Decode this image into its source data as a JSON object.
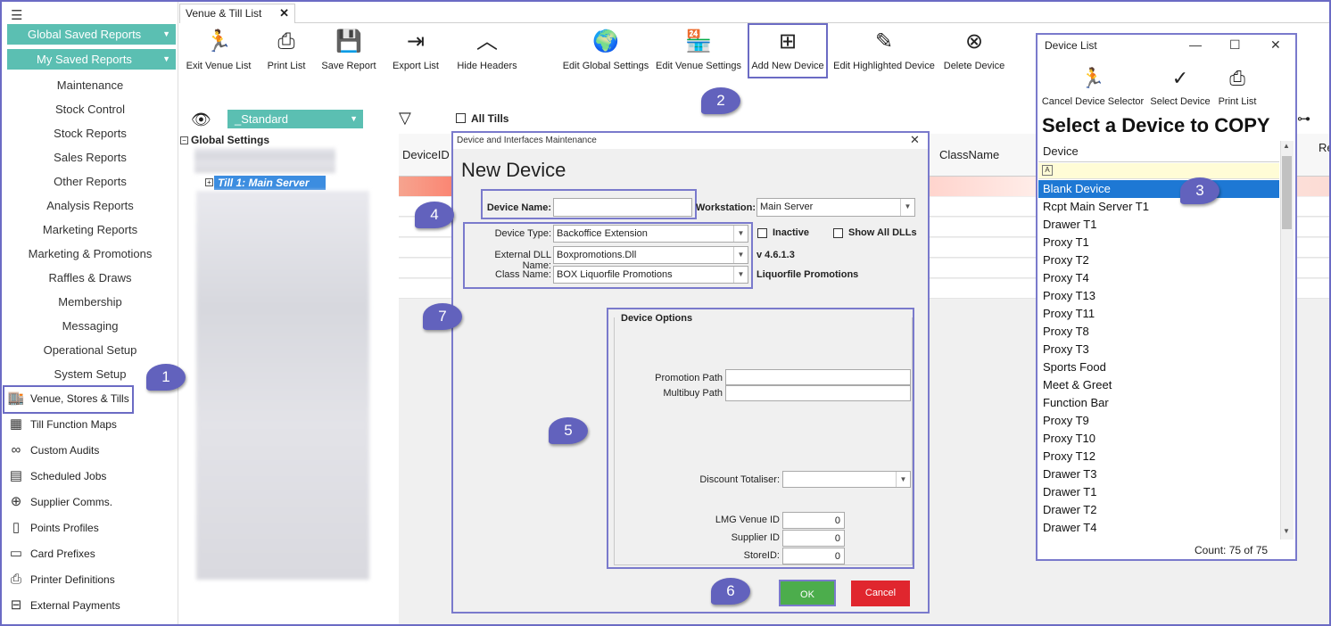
{
  "sidebar": {
    "global_saved": "Global Saved Reports",
    "my_saved": "My Saved Reports",
    "menu": [
      "Maintenance",
      "Stock Control",
      "Stock Reports",
      "Sales Reports",
      "Other Reports",
      "Analysis Reports",
      "Marketing Reports",
      "Marketing & Promotions",
      "Raffles & Draws",
      "Membership",
      "Messaging",
      "Operational Setup",
      "System Setup"
    ],
    "icon_items": [
      {
        "label": "Venue, Stores & Tills",
        "icon": "store-icon"
      },
      {
        "label": "Till Function Maps",
        "icon": "grid-icon"
      },
      {
        "label": "Custom Audits",
        "icon": "binoculars-icon"
      },
      {
        "label": "Scheduled Jobs",
        "icon": "calendar-icon"
      },
      {
        "label": "Supplier Comms.",
        "icon": "upload-icon"
      },
      {
        "label": "Points Profiles",
        "icon": "document-icon"
      },
      {
        "label": "Card Prefixes",
        "icon": "card-icon"
      },
      {
        "label": "Printer Definitions",
        "icon": "printer-icon"
      },
      {
        "label": "External Payments",
        "icon": "payment-icon"
      }
    ]
  },
  "tab": {
    "label": "Venue & Till List"
  },
  "toolbar": [
    {
      "label": "Exit Venue List",
      "icon": "exit-icon"
    },
    {
      "label": "Print List",
      "icon": "printer-icon"
    },
    {
      "label": "Save Report",
      "icon": "save-icon"
    },
    {
      "label": "Export List",
      "icon": "export-icon"
    },
    {
      "label": "Hide Headers",
      "icon": "chevron-up-icon"
    },
    {
      "label": "Edit Global Settings",
      "icon": "globe-icon"
    },
    {
      "label": "Edit Venue Settings",
      "icon": "venue-icon"
    },
    {
      "label": "Add New Device",
      "icon": "add-device-icon"
    },
    {
      "label": "Edit Highlighted Device",
      "icon": "edit-device-icon"
    },
    {
      "label": "Delete Device",
      "icon": "delete-device-icon"
    }
  ],
  "filter": {
    "report_select": "_Standard",
    "all_tills": "All Tills"
  },
  "tree": {
    "root": "Global Settings",
    "till": "Till 1: Main Server"
  },
  "grid": {
    "columns": [
      "DeviceID",
      "ClassName",
      "Re"
    ]
  },
  "dialog": {
    "title": "Device and Interfaces Maintenance",
    "heading": "New Device",
    "device_name_label": "Device Name:",
    "device_name_value": "",
    "workstation_label": "Workstation:",
    "workstation_value": "Main Server",
    "device_type_label": "Device Type:",
    "device_type_value": "Backoffice Extension",
    "dll_label": "External DLL Name:",
    "dll_value": "Boxpromotions.Dll",
    "class_label": "Class Name:",
    "class_value": "BOX Liquorfile Promotions",
    "inactive_label": "Inactive",
    "show_all_label": "Show All DLLs",
    "version": "v 4.6.1.3",
    "class_desc": "Liquorfile Promotions",
    "options_title": "Device Options",
    "promotion_path_label": "Promotion Path",
    "multibuy_path_label": "Multibuy Path",
    "discount_totaliser_label": "Discount Totaliser:",
    "lmg_label": "LMG Venue ID",
    "lmg_value": "0",
    "supplier_label": "Supplier ID",
    "supplier_value": "0",
    "store_label": "StoreID:",
    "store_value": "0",
    "ok": "OK",
    "cancel": "Cancel"
  },
  "device_list": {
    "title": "Device List",
    "tools": [
      {
        "label": "Cancel Device Selector",
        "icon": "exit-icon"
      },
      {
        "label": "Select Device",
        "icon": "check-icon"
      },
      {
        "label": "Print List",
        "icon": "printer-icon"
      }
    ],
    "heading": "Select a Device to COPY",
    "column": "Device",
    "filter_icon": "A",
    "items": [
      "Blank Device",
      "Rcpt Main Server T1",
      "Drawer T1",
      "Proxy T1",
      "Proxy T2",
      "Proxy T4",
      "Proxy T13",
      "Proxy T11",
      "Proxy T8",
      "Proxy T3",
      "Sports Food",
      "Meet & Greet",
      "Function Bar",
      "Proxy T9",
      "Proxy T10",
      "Proxy T12",
      "Drawer T3",
      "Drawer T1",
      "Drawer T2",
      "Drawer T4"
    ],
    "selected_index": 0,
    "count": "Count: 75 of 75"
  },
  "callouts": [
    "1",
    "2",
    "3",
    "4",
    "5",
    "6",
    "7"
  ],
  "colors": {
    "accent": "#5bbfb2",
    "highlight": "#6b6bc4",
    "selection": "#1e78d4",
    "ok": "#4cad4c",
    "cancel": "#e0262e"
  }
}
